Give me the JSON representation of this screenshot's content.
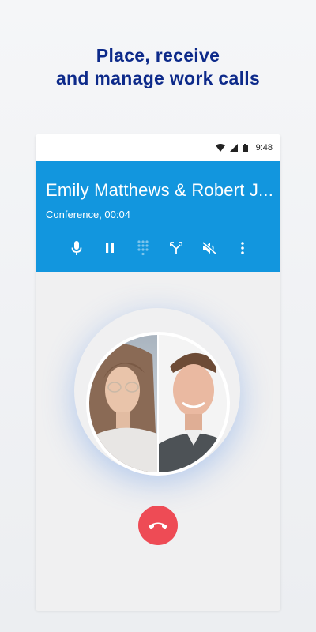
{
  "headline": {
    "line1": "Place, receive",
    "line2": "and manage work calls"
  },
  "statusbar": {
    "time": "9:48",
    "icons": [
      "wifi-icon",
      "signal-icon",
      "battery-icon"
    ]
  },
  "call": {
    "name": "Emily Matthews & Robert J...",
    "status": "Conference, 00:04",
    "header_color": "#1296de"
  },
  "controls": [
    {
      "icon": "microphone-icon",
      "enabled": true
    },
    {
      "icon": "pause-icon",
      "enabled": true
    },
    {
      "icon": "dialpad-icon",
      "enabled": false
    },
    {
      "icon": "merge-icon",
      "enabled": true
    },
    {
      "icon": "speaker-mute-icon",
      "enabled": true
    },
    {
      "icon": "more-vertical-icon",
      "enabled": true
    }
  ],
  "hangup": {
    "icon": "end-call-icon",
    "color": "#ee4b55"
  },
  "participants": [
    "woman-with-glasses-photo",
    "man-smiling-photo"
  ]
}
